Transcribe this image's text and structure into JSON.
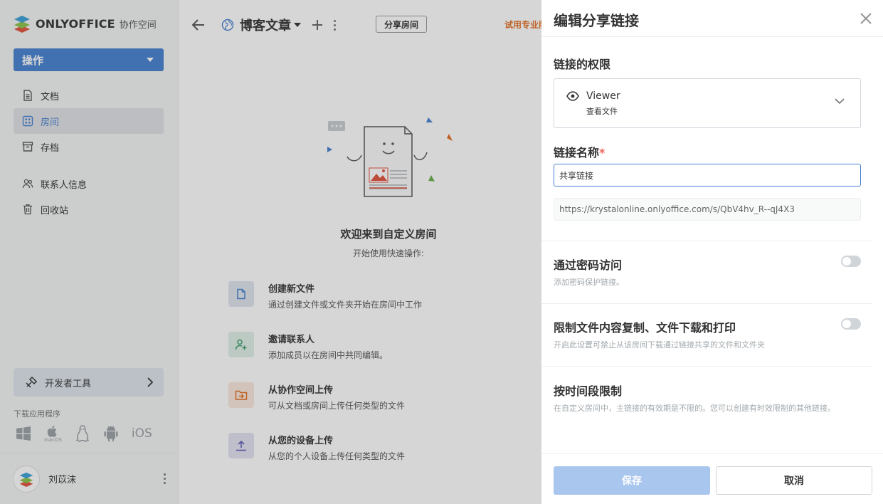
{
  "sidebar": {
    "logo_word": "ONLYOFFICE",
    "logo_sub": "协作空间",
    "action_label": "操作",
    "nav": [
      {
        "label": "文档",
        "icon": "document-icon"
      },
      {
        "label": "房间",
        "icon": "rooms-icon"
      },
      {
        "label": "存档",
        "icon": "archive-icon"
      },
      {
        "label": "联系人信息",
        "icon": "contacts-icon"
      },
      {
        "label": "回收站",
        "icon": "trash-icon"
      }
    ],
    "dev_tools_label": "开发者工具",
    "download_label": "下载应用程序",
    "app_ios_label": "iOS",
    "app_macos_label": "macOS",
    "user_name": "刘苡沫"
  },
  "main": {
    "room_title": "博客文章",
    "share_room_label": "分享房间",
    "trial_label": "试用专业版",
    "welcome_title": "欢迎来到自定义房间",
    "welcome_sub": "开始使用快速操作:",
    "quick_actions": [
      {
        "title": "创建新文件",
        "desc": "通过创建文件或文件夹开始在房间中工作",
        "color": "#dfe5ee",
        "icon_color": "#4781d1"
      },
      {
        "title": "邀请联系人",
        "desc": "添加成员以在房间中共同编辑。",
        "color": "#dff0e8",
        "icon_color": "#3b9d6b"
      },
      {
        "title": "从协作空间上传",
        "desc": "可从文档或房间上传任何类型的文件",
        "color": "#fbe9dc",
        "icon_color": "#e36f24"
      },
      {
        "title": "从您的设备上传",
        "desc": "从您的个人设备上传任何类型的文件",
        "color": "#e3e3f3",
        "icon_color": "#5f5fb8"
      }
    ]
  },
  "panel": {
    "title": "编辑分享链接",
    "perm_label": "链接的权限",
    "perm_name": "Viewer",
    "perm_desc": "查看文件",
    "link_name_label": "链接名称",
    "required_mark": "*",
    "link_name_value": "共享链接",
    "link_url": "https://krystalonline.onlyoffice.com/s/QbV4hv_R--qJ4X3",
    "password_title": "通过密码访问",
    "password_desc": "添加密码保护链接。",
    "restrict_title": "限制文件内容复制、文件下载和打印",
    "restrict_desc": "开启此设置可禁止从该房间下载通过链接共享的文件和文件夹",
    "time_title": "按时间段限制",
    "time_desc": "在自定义房间中，主链接的有效期是不限的。您可以创建有时效限制的其他链接。",
    "save_label": "保存",
    "cancel_label": "取消"
  }
}
